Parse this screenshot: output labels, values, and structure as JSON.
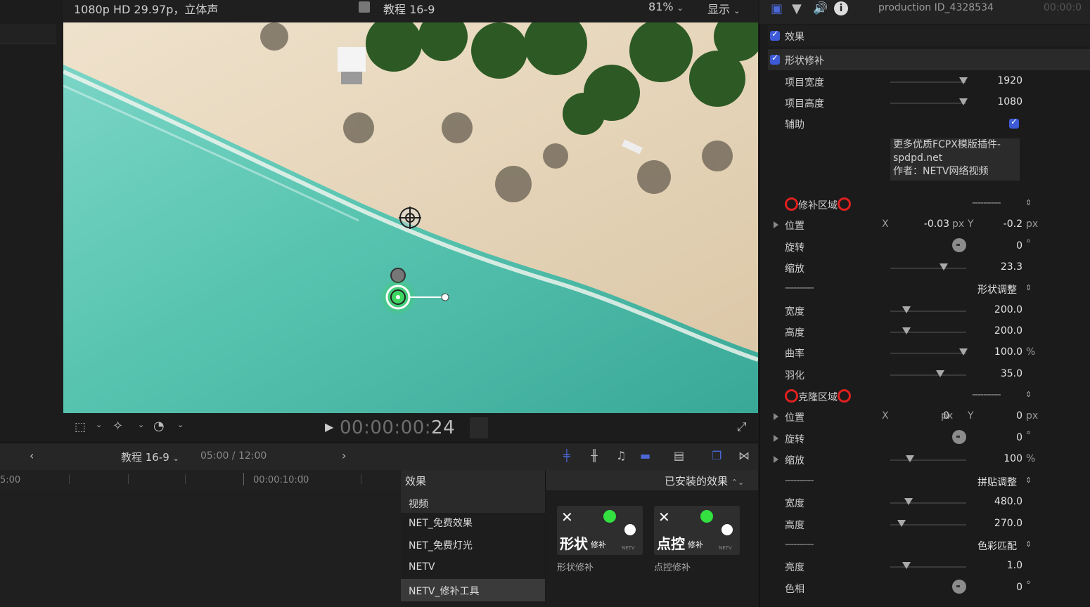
{
  "viewer": {
    "format": "1080p HD 29.97p，立体声",
    "project_title": "教程 16-9",
    "zoom": "81%",
    "display_label": "显示",
    "timecode_dim": "00:00:00:",
    "timecode_frames": "24"
  },
  "timeline": {
    "project_name": "教程 16-9",
    "duration": "05:00 / 12:00",
    "ruler_left": "5:00",
    "ruler_mark": "00:00:10:00"
  },
  "effects_browser": {
    "header": "效果",
    "installed_label": "已安装的效果",
    "categories": [
      {
        "label": "视频",
        "selected": false,
        "header": true
      },
      {
        "label": "NET_免费效果",
        "selected": false
      },
      {
        "label": "NET_免费灯光",
        "selected": false
      },
      {
        "label": "NETV",
        "selected": false
      },
      {
        "label": "NETV_修补工具",
        "selected": true
      }
    ],
    "items": [
      {
        "thumb_text": "形状",
        "thumb_small": "修补",
        "label": "形状修补"
      },
      {
        "thumb_text": "点控",
        "thumb_small": "修补",
        "label": "点控修补"
      }
    ],
    "brand_mark": "NETV"
  },
  "inspector": {
    "clip_name": "production ID_4328534",
    "clip_time": "00:00:0",
    "effects_label": "效果",
    "effect_name": "形状修补",
    "watermark_lines": [
      "更多优质FCPX模版插件-",
      "spdpd.net",
      "作者：NETV网络视频"
    ],
    "rows": {
      "project_width": {
        "label": "项目宽度",
        "value": "1920",
        "level": 0.95
      },
      "project_height": {
        "label": "项目高度",
        "value": "1080",
        "level": 0.95
      },
      "assist": {
        "label": "辅助",
        "checked": true
      },
      "patch_area": {
        "label": "修补区域",
        "dropdown": "----------"
      },
      "position1": {
        "label": "位置",
        "x_label": "X",
        "x": "-0.03",
        "y_label": "Y",
        "y": "-0.2",
        "unit": "px"
      },
      "rotation1": {
        "label": "旋转",
        "value": "0",
        "unit": "°"
      },
      "scale1": {
        "label": "缩放",
        "value": "23.3",
        "level": 0.7
      },
      "shape_adjust": {
        "dashes": "----------",
        "dropdown": "形状调整"
      },
      "width1": {
        "label": "宽度",
        "value": "200.0",
        "level": 0.2
      },
      "height1": {
        "label": "高度",
        "value": "200.0",
        "level": 0.2
      },
      "curvature": {
        "label": "曲率",
        "value": "100.0",
        "unit": "%",
        "level": 0.95
      },
      "feather": {
        "label": "羽化",
        "value": "35.0",
        "level": 0.65
      },
      "clone_area": {
        "label": "克隆区域",
        "dropdown": "----------"
      },
      "position2": {
        "label": "位置",
        "x_label": "X",
        "x": "0",
        "y_label": "Y",
        "y": "0",
        "unit": "px"
      },
      "rotation2": {
        "label": "旋转",
        "value": "0",
        "unit": "°"
      },
      "scale2": {
        "label": "缩放",
        "value": "100",
        "unit": "%",
        "level": 0.25
      },
      "tile_adjust": {
        "dashes": "----------",
        "dropdown": "拼贴调整"
      },
      "width2": {
        "label": "宽度",
        "value": "480.0",
        "level": 0.25
      },
      "height2": {
        "label": "高度",
        "value": "270.0",
        "level": 0.15
      },
      "color_match": {
        "dashes": "----------",
        "dropdown": "色彩匹配"
      },
      "brightness": {
        "label": "亮度",
        "value": "1.0",
        "level": 0.2
      },
      "hue": {
        "label": "色相",
        "value": "0",
        "unit": "°"
      }
    }
  },
  "colors": {
    "accent": "#3d5bd6",
    "red_marker": "#e02020",
    "onscreen_green": "#33e040",
    "water": "#56c4b0",
    "sand": "#e2d3b8"
  }
}
